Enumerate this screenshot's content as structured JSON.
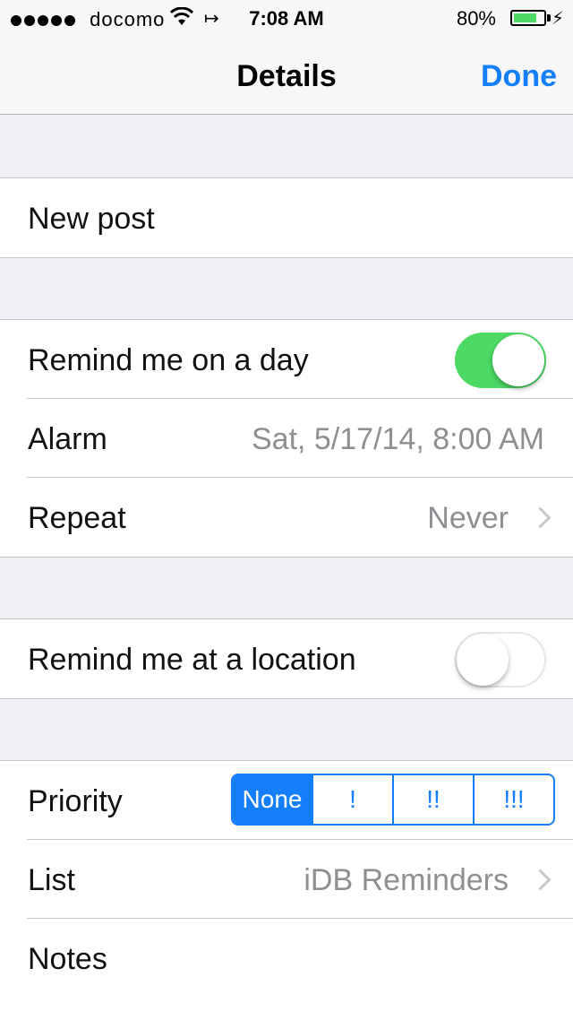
{
  "status_bar": {
    "carrier": "docomo",
    "time": "7:08 AM",
    "battery_percent": "80%",
    "battery_level": 0.8,
    "icons": [
      "signal-dots-icon",
      "wifi-icon",
      "location-arrow-icon",
      "battery-icon",
      "charging-bolt-icon"
    ]
  },
  "nav": {
    "title": "Details",
    "done_label": "Done"
  },
  "title_row": {
    "text": "New post"
  },
  "day_group": {
    "remind_day_label": "Remind me on a day",
    "remind_day_on": true,
    "alarm_label": "Alarm",
    "alarm_value": "Sat, 5/17/14, 8:00 AM",
    "repeat_label": "Repeat",
    "repeat_value": "Never"
  },
  "location_group": {
    "remind_location_label": "Remind me at a location",
    "remind_location_on": false
  },
  "details_group": {
    "priority_label": "Priority",
    "priority_options": [
      "None",
      "!",
      "!!",
      "!!!"
    ],
    "priority_selected": "None",
    "list_label": "List",
    "list_value": "iDB Reminders",
    "notes_label": "Notes"
  },
  "colors": {
    "accent": "#147efb",
    "switch_on": "#4cd964",
    "background": "#efeff4"
  }
}
